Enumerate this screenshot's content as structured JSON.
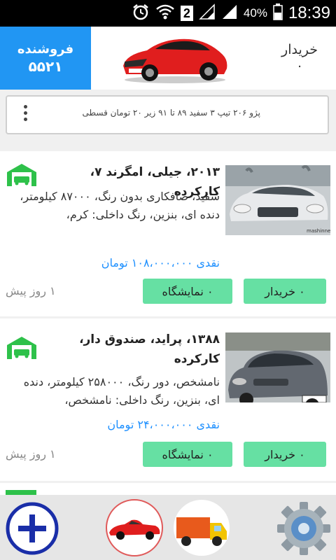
{
  "status_bar": {
    "battery_percent": "40%",
    "time": "18:39",
    "sim_badge": "2",
    "icons": [
      "alarm-icon",
      "wifi-icon",
      "sim-2-icon",
      "signal-icon",
      "signal-full-icon",
      "battery-icon"
    ]
  },
  "header": {
    "seller": {
      "label": "فروشنده",
      "count": "۵۵۲۱"
    },
    "buyer": {
      "label": "خریدار",
      "count": "۰"
    },
    "logo_icon": "red-sports-car-icon"
  },
  "search": {
    "text": "پژو ۲۰۶ تیپ ۳ سفید ۸۹ تا ۹۱ زیر ۲۰ تومان قسطی",
    "menu_icon": "more-vertical-icon"
  },
  "listings": [
    {
      "title": "۲۰۱۳، جیلی، امگرند ۷، کارکرده",
      "description": "سفید، صافکاری بدون رنگ، ۸۷۰۰۰ کیلومتر، دنده ای، بنزین، رنگ داخلی: کرم،",
      "price": "نقدی ۱۰۸،۰۰۰،۰۰۰ تومان",
      "dealer_button": "۰ نمایشگاه",
      "buyer_button": "۰ خریدار",
      "posted": "۱ روز پیش",
      "thumb_color": "#d9dde0",
      "thumb_caption": "mashinnet.com",
      "garage_icon": "garage-icon"
    },
    {
      "title": "۱۳۸۸، پراید، صندوق دار، کارکرده",
      "description": "نامشخص، دور رنگ، ۲۵۸۰۰۰ کیلومتر، دنده ای، بنزین، رنگ داخلی: نامشخص،",
      "price": "نقدی ۲۴،۰۰۰،۰۰۰ تومان",
      "dealer_button": "۰ نمایشگاه",
      "buyer_button": "۰ خریدار",
      "posted": "۱ روز پیش",
      "thumb_color": "#5f656a",
      "garage_icon": "garage-icon"
    }
  ],
  "bottom_nav": {
    "items": [
      "add-circle-icon",
      "red-car-icon",
      "truck-icon",
      "settings-gear-icon"
    ]
  },
  "colors": {
    "seller_blue": "#2196f3",
    "button_green": "#66e0a3",
    "price_blue": "#1e90ff",
    "garage_green": "#2ec14a",
    "add_blue": "#1a2ea8"
  }
}
